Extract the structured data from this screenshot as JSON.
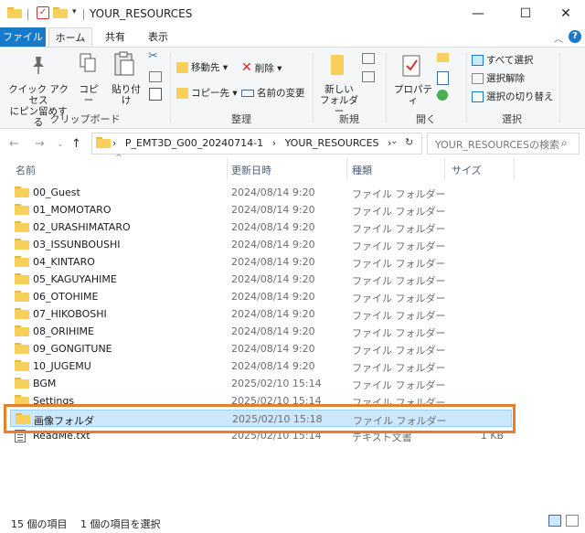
{
  "window": {
    "title": "YOUR_RESOURCES",
    "qa_dropdown": "▾",
    "minimize": "—",
    "maximize": "☐",
    "close": "✕"
  },
  "tabs": [
    {
      "label": "ファイル"
    },
    {
      "label": "ホーム"
    },
    {
      "label": "共有"
    },
    {
      "label": "表示"
    }
  ],
  "ribbon": {
    "clipboard": {
      "label": "クリップボード",
      "pin_label_1": "クイック アクセス",
      "pin_label_2": "にピン留めする",
      "copy_label": "コピー",
      "paste_label": "貼り付け"
    },
    "organize": {
      "label": "整理",
      "move_to": "移動先 ▾",
      "copy_to": "コピー先 ▾",
      "delete": "削除 ▾",
      "rename": "名前の変更"
    },
    "new": {
      "label": "新規",
      "new_folder_1": "新しい",
      "new_folder_2": "フォルダー"
    },
    "open": {
      "label": "開く",
      "properties": "プロパティ"
    },
    "select": {
      "label": "選択",
      "select_all": "すべて選択",
      "select_none": "選択解除",
      "invert": "選択の切り替え"
    }
  },
  "address": {
    "path": [
      "P_EMT3D_G00_20240714-1",
      "YOUR_RESOURCES"
    ],
    "separator": "›",
    "search_placeholder": "YOUR_RESOURCESの検索"
  },
  "columns": {
    "name": "名前",
    "date": "更新日時",
    "type": "種類",
    "size": "サイズ"
  },
  "files": [
    {
      "name": "00_Guest",
      "date": "2024/08/14 9:20",
      "type": "ファイル フォルダー",
      "size": "",
      "icon": "folder-icon"
    },
    {
      "name": "01_MOMOTARO",
      "date": "2024/08/14 9:20",
      "type": "ファイル フォルダー",
      "size": "",
      "icon": "folder-icon"
    },
    {
      "name": "02_URASHIMATARO",
      "date": "2024/08/14 9:20",
      "type": "ファイル フォルダー",
      "size": "",
      "icon": "folder-icon"
    },
    {
      "name": "03_ISSUNBOUSHI",
      "date": "2024/08/14 9:20",
      "type": "ファイル フォルダー",
      "size": "",
      "icon": "folder-icon"
    },
    {
      "name": "04_KINTARO",
      "date": "2024/08/14 9:20",
      "type": "ファイル フォルダー",
      "size": "",
      "icon": "folder-icon"
    },
    {
      "name": "05_KAGUYAHIME",
      "date": "2024/08/14 9:20",
      "type": "ファイル フォルダー",
      "size": "",
      "icon": "folder-icon"
    },
    {
      "name": "06_OTOHIME",
      "date": "2024/08/14 9:20",
      "type": "ファイル フォルダー",
      "size": "",
      "icon": "folder-icon"
    },
    {
      "name": "07_HIKOBOSHI",
      "date": "2024/08/14 9:20",
      "type": "ファイル フォルダー",
      "size": "",
      "icon": "folder-icon"
    },
    {
      "name": "08_ORIHIME",
      "date": "2024/08/14 9:20",
      "type": "ファイル フォルダー",
      "size": "",
      "icon": "folder-icon"
    },
    {
      "name": "09_GONGITUNE",
      "date": "2024/08/14 9:20",
      "type": "ファイル フォルダー",
      "size": "",
      "icon": "folder-icon"
    },
    {
      "name": "10_JUGEMU",
      "date": "2024/08/14 9:20",
      "type": "ファイル フォルダー",
      "size": "",
      "icon": "folder-icon"
    },
    {
      "name": "BGM",
      "date": "2025/02/10 15:14",
      "type": "ファイル フォルダー",
      "size": "",
      "icon": "folder-icon"
    },
    {
      "name": "Settings",
      "date": "2025/02/10 15:14",
      "type": "ファイル フォルダー",
      "size": "",
      "icon": "folder-icon"
    },
    {
      "name": "画像フォルダ",
      "date": "2025/02/10 15:18",
      "type": "ファイル フォルダー",
      "size": "",
      "icon": "folder-icon",
      "selected": true
    },
    {
      "name": "ReadMe.txt",
      "date": "2025/02/10 15:14",
      "type": "テキスト文書",
      "size": "1 KB",
      "icon": "text-file-icon"
    }
  ],
  "status": {
    "item_count": "15 個の項目",
    "selected_count": "1 個の項目を選択"
  },
  "colors": {
    "accent": "#1979ca",
    "selection": "#cce8ff",
    "highlight_box": "#e57f2b",
    "folder": "#f7cf5b"
  }
}
